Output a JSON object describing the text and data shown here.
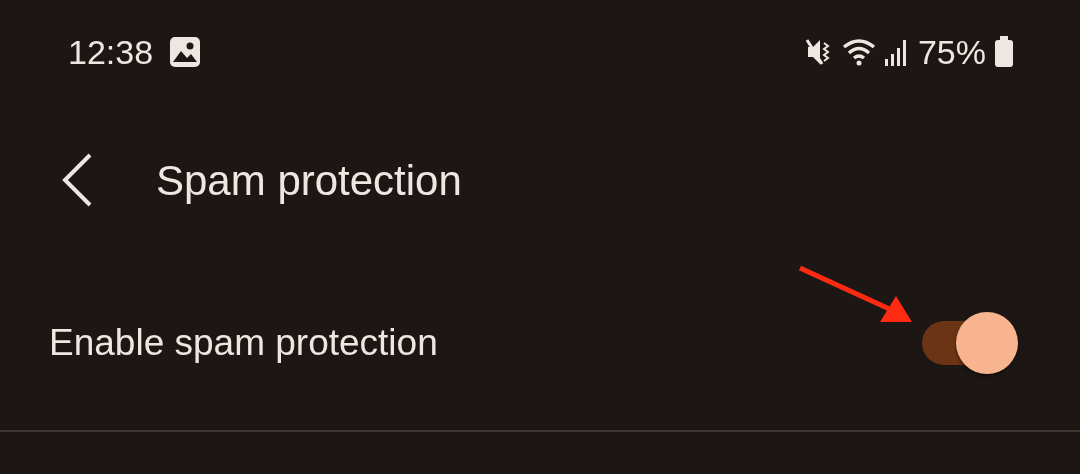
{
  "status_bar": {
    "time": "12:38",
    "battery_text": "75%"
  },
  "header": {
    "title": "Spam protection"
  },
  "settings": [
    {
      "kind": "switch",
      "label": "Enable spam protection",
      "on": true
    }
  ]
}
